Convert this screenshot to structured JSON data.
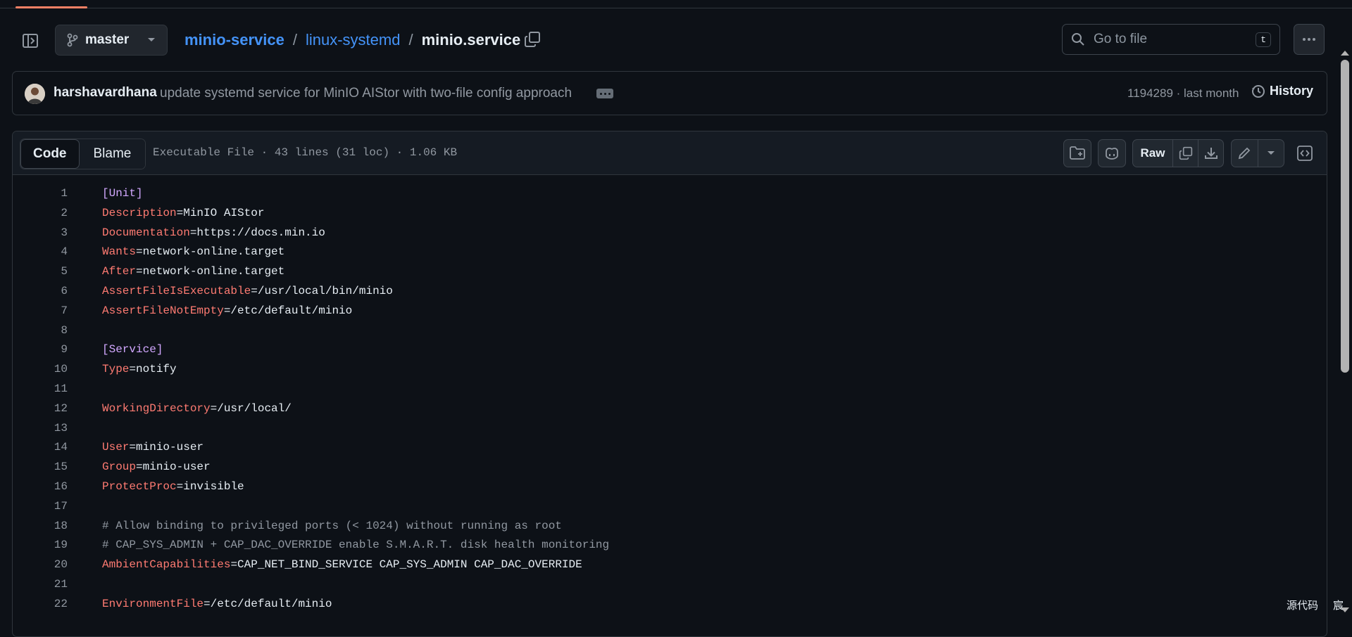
{
  "header": {
    "branch_label": "master",
    "breadcrumb": {
      "repo": "minio-service",
      "dir": "linux-systemd",
      "sep": "/",
      "file": "minio.service"
    },
    "search_placeholder": "Go to file",
    "search_shortcut": "t"
  },
  "commit": {
    "author": "harshavardhana",
    "message": "update systemd service for MinIO AIStor with two-file config approach",
    "sha_time": "1194289 · last month",
    "history_label": "History"
  },
  "file": {
    "tabs": [
      "Code",
      "Blame"
    ],
    "info": "Executable File · 43 lines (31 loc) · 1.06 KB",
    "raw_label": "Raw"
  },
  "code_lines": [
    {
      "n": "1",
      "parts": [
        [
          "sec",
          "[Unit]"
        ]
      ]
    },
    {
      "n": "2",
      "parts": [
        [
          "key",
          "Description"
        ],
        [
          "val",
          "=MinIO AIStor"
        ]
      ]
    },
    {
      "n": "3",
      "parts": [
        [
          "key",
          "Documentation"
        ],
        [
          "val",
          "=https://docs.min.io"
        ]
      ]
    },
    {
      "n": "4",
      "parts": [
        [
          "key",
          "Wants"
        ],
        [
          "val",
          "=network-online.target"
        ]
      ]
    },
    {
      "n": "5",
      "parts": [
        [
          "key",
          "After"
        ],
        [
          "val",
          "=network-online.target"
        ]
      ]
    },
    {
      "n": "6",
      "parts": [
        [
          "key",
          "AssertFileIsExecutable"
        ],
        [
          "val",
          "=/usr/local/bin/minio"
        ]
      ]
    },
    {
      "n": "7",
      "parts": [
        [
          "key",
          "AssertFileNotEmpty"
        ],
        [
          "val",
          "=/etc/default/minio"
        ]
      ]
    },
    {
      "n": "8",
      "parts": []
    },
    {
      "n": "9",
      "parts": [
        [
          "sec",
          "[Service]"
        ]
      ]
    },
    {
      "n": "10",
      "parts": [
        [
          "key",
          "Type"
        ],
        [
          "val",
          "=notify"
        ]
      ]
    },
    {
      "n": "11",
      "parts": []
    },
    {
      "n": "12",
      "parts": [
        [
          "key",
          "WorkingDirectory"
        ],
        [
          "val",
          "=/usr/local/"
        ]
      ]
    },
    {
      "n": "13",
      "parts": []
    },
    {
      "n": "14",
      "parts": [
        [
          "key",
          "User"
        ],
        [
          "val",
          "=minio-user"
        ]
      ]
    },
    {
      "n": "15",
      "parts": [
        [
          "key",
          "Group"
        ],
        [
          "val",
          "=minio-user"
        ]
      ]
    },
    {
      "n": "16",
      "parts": [
        [
          "key",
          "ProtectProc"
        ],
        [
          "val",
          "=invisible"
        ]
      ]
    },
    {
      "n": "17",
      "parts": []
    },
    {
      "n": "18",
      "parts": [
        [
          "cmt",
          "# Allow binding to privileged ports (< 1024) without running as root"
        ]
      ]
    },
    {
      "n": "19",
      "parts": [
        [
          "cmt",
          "# CAP_SYS_ADMIN + CAP_DAC_OVERRIDE enable S.M.A.R.T. disk health monitoring"
        ]
      ]
    },
    {
      "n": "20",
      "parts": [
        [
          "key",
          "AmbientCapabilities"
        ],
        [
          "val",
          "=CAP_NET_BIND_SERVICE CAP_SYS_ADMIN CAP_DAC_OVERRIDE"
        ]
      ]
    },
    {
      "n": "21",
      "parts": []
    },
    {
      "n": "22",
      "parts": [
        [
          "key",
          "EnvironmentFile"
        ],
        [
          "val",
          "=/etc/default/minio"
        ]
      ]
    }
  ],
  "overlay": {
    "source_btn": "源代码",
    "extra_btn": "宸"
  },
  "colors": {
    "bg": "#0d1117",
    "link": "#4493f8",
    "keyword": "#ff7b72",
    "section": "#d2a8ff",
    "comment": "#9198a1"
  }
}
